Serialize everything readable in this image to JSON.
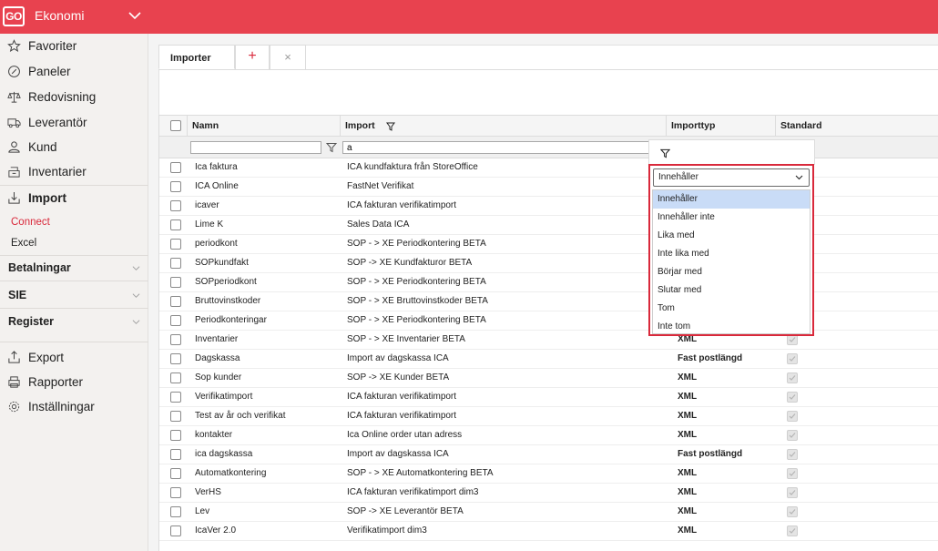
{
  "app": {
    "logo": "GO",
    "title": "Ekonomi"
  },
  "sidebar": {
    "top_items": [
      {
        "label": "Favoriter",
        "icon": "star-icon"
      },
      {
        "label": "Paneler",
        "icon": "gauge-icon"
      },
      {
        "label": "Redovisning",
        "icon": "scale-icon"
      },
      {
        "label": "Leverantör",
        "icon": "truck-icon"
      },
      {
        "label": "Kund",
        "icon": "person-icon"
      },
      {
        "label": "Inventarier",
        "icon": "inventory-icon"
      },
      {
        "label": "Import",
        "icon": "import-icon"
      }
    ],
    "import_sub": [
      {
        "label": "Connect",
        "active": true
      },
      {
        "label": "Excel",
        "active": false
      }
    ],
    "groups": [
      {
        "label": "Betalningar"
      },
      {
        "label": "SIE"
      },
      {
        "label": "Register"
      }
    ],
    "bottom_items": [
      {
        "label": "Export",
        "icon": "export-icon"
      },
      {
        "label": "Rapporter",
        "icon": "printer-icon"
      },
      {
        "label": "Inställningar",
        "icon": "gear-icon"
      }
    ]
  },
  "tabs": {
    "active": "Importer",
    "add": "+",
    "close": "×"
  },
  "grid": {
    "columns": {
      "name": "Namn",
      "import": "Import",
      "type": "Importtyp",
      "standard": "Standard"
    },
    "filter": {
      "name_value": "",
      "import_value": "a"
    },
    "rows": [
      {
        "name": "Ica faktura",
        "import": "ICA kundfaktura från StoreOffice",
        "type": ""
      },
      {
        "name": "ICA Online",
        "import": "FastNet Verifikat",
        "type": ""
      },
      {
        "name": "icaver",
        "import": "ICA fakturan verifikatimport",
        "type": ""
      },
      {
        "name": "Lime K",
        "import": "Sales Data ICA",
        "type": ""
      },
      {
        "name": "periodkont",
        "import": "SOP - > XE Periodkontering BETA",
        "type": ""
      },
      {
        "name": "SOPkundfakt",
        "import": "SOP -> XE Kundfakturor BETA",
        "type": ""
      },
      {
        "name": "SOPperiodkont",
        "import": "SOP - > XE Periodkontering BETA",
        "type": ""
      },
      {
        "name": "Bruttovinstkoder",
        "import": "SOP - > XE Bruttovinstkoder BETA",
        "type": ""
      },
      {
        "name": "Periodkonteringar",
        "import": "SOP - > XE Periodkontering BETA",
        "type": ""
      },
      {
        "name": "Inventarier",
        "import": "SOP - > XE Inventarier BETA",
        "type": "XML"
      },
      {
        "name": "Dagskassa",
        "import": "Import av dagskassa ICA",
        "type": "Fast postlängd"
      },
      {
        "name": "Sop kunder",
        "import": "SOP -> XE Kunder BETA",
        "type": "XML"
      },
      {
        "name": "Verifikatimport",
        "import": "ICA fakturan verifikatimport",
        "type": "XML"
      },
      {
        "name": "Test av år och verifikat",
        "import": "ICA fakturan verifikatimport",
        "type": "XML"
      },
      {
        "name": "kontakter",
        "import": "Ica Online order utan adress",
        "type": "XML"
      },
      {
        "name": "ica dagskassa",
        "import": "Import av dagskassa ICA",
        "type": "Fast postlängd"
      },
      {
        "name": "Automatkontering",
        "import": "SOP - > XE Automatkontering BETA",
        "type": "XML"
      },
      {
        "name": "VerHS",
        "import": "ICA fakturan verifikatimport dim3",
        "type": "XML"
      },
      {
        "name": "Lev",
        "import": "SOP -> XE Leverantör BETA",
        "type": "XML"
      },
      {
        "name": "IcaVer 2.0",
        "import": "Verifikatimport dim3",
        "type": "XML"
      }
    ]
  },
  "filter_dropdown": {
    "selected": "Innehåller",
    "options": [
      "Innehåller",
      "Innehåller inte",
      "Lika med",
      "Inte lika med",
      "Börjar med",
      "Slutar med",
      "Tom",
      "Inte tom"
    ]
  },
  "colors": {
    "brand": "#e8424f",
    "active_nav": "#d9293b",
    "highlight": "#c9dcf7"
  }
}
